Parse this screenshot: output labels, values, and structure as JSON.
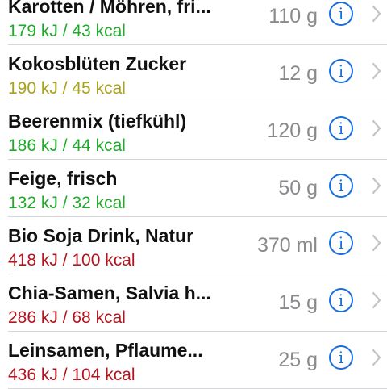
{
  "items": [
    {
      "name": "Karotten / Möhren, fri...",
      "energy": "179 kJ / 43 kcal",
      "amount": "110 g",
      "color": "#1faa2a"
    },
    {
      "name": "Kokosblüten Zucker",
      "energy": "190 kJ / 45 kcal",
      "amount": "12 g",
      "color": "#a8a21a"
    },
    {
      "name": "Beerenmix (tiefkühl)",
      "energy": "186 kJ / 44 kcal",
      "amount": "120 g",
      "color": "#1faa2a"
    },
    {
      "name": "Feige, frisch",
      "energy": "132 kJ / 32 kcal",
      "amount": "50 g",
      "color": "#1faa2a"
    },
    {
      "name": "Bio Soja Drink, Natur",
      "energy": "418 kJ / 100 kcal",
      "amount": "370 ml",
      "color": "#b3141d"
    },
    {
      "name": "Chia-Samen, Salvia h...",
      "energy": "286 kJ / 68 kcal",
      "amount": "15 g",
      "color": "#b3141d"
    },
    {
      "name": "Leinsamen, Pflaume...",
      "energy": "436 kJ / 104 kcal",
      "amount": "25 g",
      "color": "#b3141d"
    }
  ],
  "info_glyph": "i",
  "icons": {
    "info": "info-icon",
    "disclosure": "chevron-right-icon"
  },
  "accent_color": "#1a6fe0"
}
